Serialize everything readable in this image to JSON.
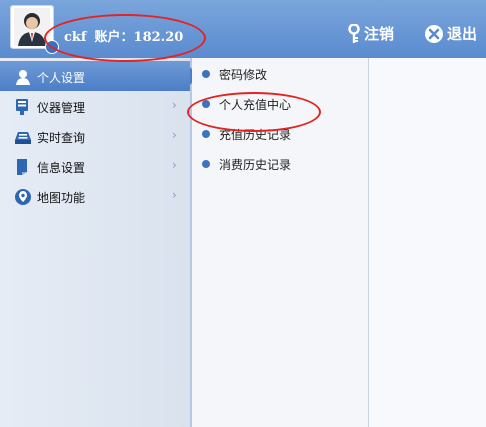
{
  "header": {
    "username": "ckf",
    "account_label": "账户：",
    "balance": "182.20",
    "logout_label": "注销",
    "exit_label": "退出"
  },
  "sidebar": {
    "items": [
      {
        "label": "个人设置",
        "icon": "user-icon",
        "active": true
      },
      {
        "label": "仪器管理",
        "icon": "device-icon"
      },
      {
        "label": "实时查询",
        "icon": "realtime-query-icon"
      },
      {
        "label": "信息设置",
        "icon": "info-settings-icon"
      },
      {
        "label": "地图功能",
        "icon": "map-icon"
      }
    ]
  },
  "submenu": {
    "items": [
      {
        "label": "密码修改"
      },
      {
        "label": "个人充值中心"
      },
      {
        "label": "充值历史记录"
      },
      {
        "label": "消费历史记录"
      }
    ]
  },
  "colors": {
    "header": "#5b8bcf",
    "active_menu": "#4c7ec7",
    "annotation": "#e12424"
  }
}
